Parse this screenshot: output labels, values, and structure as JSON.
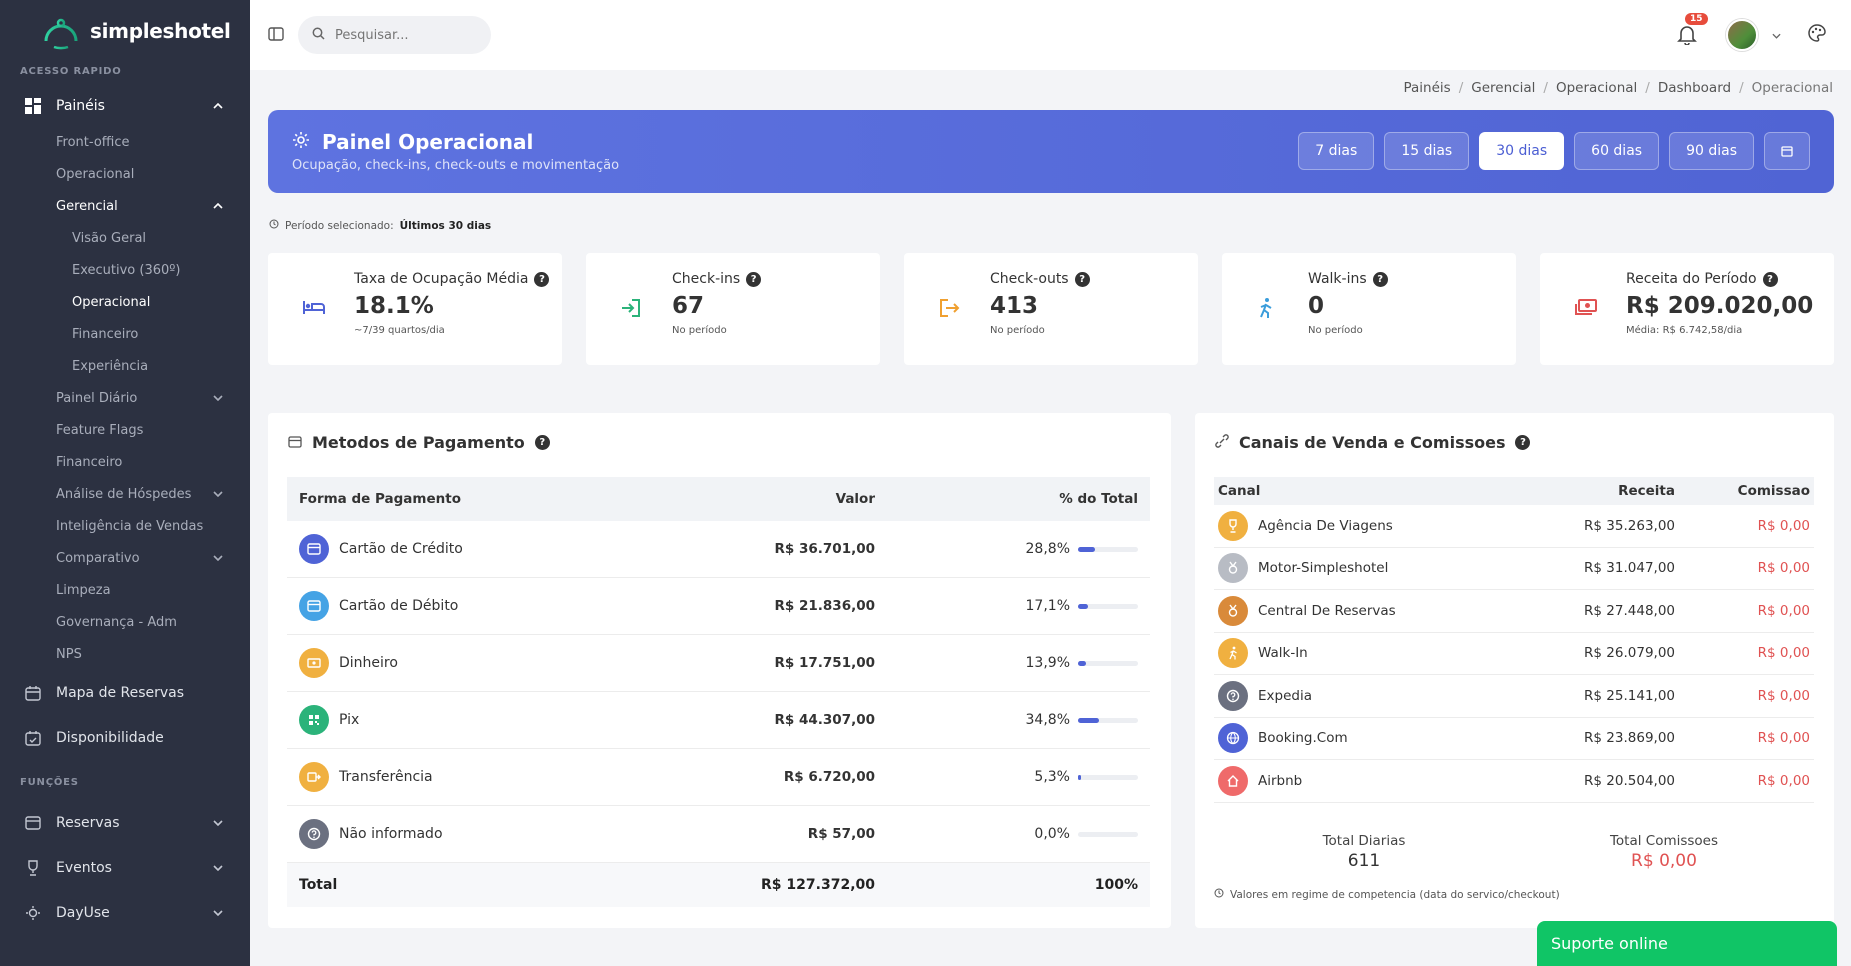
{
  "app": {
    "name": "simpleshotel"
  },
  "sidebar": {
    "section_quick": "ACESSO RAPIDO",
    "paineis": "Painéis",
    "sub": [
      "Front-office",
      "Operacional"
    ],
    "gerencial": "Gerencial",
    "gerencial_items": [
      "Visão Geral",
      "Executivo (360º)",
      "Operacional",
      "Financeiro",
      "Experiência"
    ],
    "more": [
      {
        "label": "Painel Diário",
        "chevron": true
      },
      {
        "label": "Feature Flags",
        "chevron": false
      },
      {
        "label": "Financeiro",
        "chevron": false
      },
      {
        "label": "Análise de Hóspedes",
        "chevron": true
      },
      {
        "label": "Inteligência de Vendas",
        "chevron": false
      },
      {
        "label": "Comparativo",
        "chevron": true
      },
      {
        "label": "Limpeza",
        "chevron": false
      },
      {
        "label": "Governança - Adm",
        "chevron": false
      },
      {
        "label": "NPS",
        "chevron": false
      }
    ],
    "mapa": "Mapa de Reservas",
    "disponibilidade": "Disponibilidade",
    "section_funcoes": "FUNÇÕES",
    "reservas": "Reservas",
    "eventos": "Eventos",
    "dayuse": "DayUse"
  },
  "topbar": {
    "search_placeholder": "Pesquisar...",
    "notifications": "15"
  },
  "breadcrumb": [
    "Painéis",
    "Gerencial",
    "Operacional",
    "Dashboard",
    "Operacional"
  ],
  "hero": {
    "title": "Painel Operacional",
    "subtitle": "Ocupação, check-ins, check-outs e movimentação",
    "ranges": [
      "7 dias",
      "15 dias",
      "30 dias",
      "60 dias",
      "90 dias"
    ],
    "active_range": "30 dias"
  },
  "period": {
    "label": "Período selecionado:",
    "value": "Últimos 30 dias"
  },
  "stats": [
    {
      "title": "Taxa de Ocupação Média",
      "value": "18.1%",
      "sub": "~7/39 quartos/dia",
      "color": "#4f63d6"
    },
    {
      "title": "Check-ins",
      "value": "67",
      "sub": "No período",
      "color": "#2bb37a"
    },
    {
      "title": "Check-outs",
      "value": "413",
      "sub": "No período",
      "color": "#f0a030"
    },
    {
      "title": "Walk-ins",
      "value": "0",
      "sub": "No período",
      "color": "#3b9ddb"
    },
    {
      "title": "Receita do Período",
      "value": "R$ 209.020,00",
      "sub": "Média: R$ 6.742,58/dia",
      "color": "#e05252"
    }
  ],
  "payments": {
    "title": "Metodos de Pagamento",
    "headers": [
      "Forma de Pagamento",
      "Valor",
      "% do Total"
    ],
    "rows": [
      {
        "name": "Cartão de Crédito",
        "value": "R$ 36.701,00",
        "pct": "28,8%",
        "frac": 0.288,
        "color": "#4f63d6"
      },
      {
        "name": "Cartão de Débito",
        "value": "R$ 21.836,00",
        "pct": "17,1%",
        "frac": 0.171,
        "color": "#45a3e5"
      },
      {
        "name": "Dinheiro",
        "value": "R$ 17.751,00",
        "pct": "13,9%",
        "frac": 0.139,
        "color": "#f0b040"
      },
      {
        "name": "Pix",
        "value": "R$ 44.307,00",
        "pct": "34,8%",
        "frac": 0.348,
        "color": "#2bb37a"
      },
      {
        "name": "Transferência",
        "value": "R$ 6.720,00",
        "pct": "5,3%",
        "frac": 0.053,
        "color": "#f0b040"
      },
      {
        "name": "Não informado",
        "value": "R$ 57,00",
        "pct": "0,0%",
        "frac": 0.0,
        "color": "#6b7080"
      }
    ],
    "total_label": "Total",
    "total_value": "R$ 127.372,00",
    "total_pct": "100%"
  },
  "channels": {
    "title": "Canais de Venda e Comissoes",
    "headers": [
      "Canal",
      "Receita",
      "Comissao"
    ],
    "rows": [
      {
        "name": "Agência De Viagens",
        "revenue": "R$ 35.263,00",
        "commission": "R$ 0,00",
        "color": "#f0b040"
      },
      {
        "name": "Motor-Simpleshotel",
        "revenue": "R$ 31.047,00",
        "commission": "R$ 0,00",
        "color": "#b8bcc4"
      },
      {
        "name": "Central De Reservas",
        "revenue": "R$ 27.448,00",
        "commission": "R$ 0,00",
        "color": "#d98a3a"
      },
      {
        "name": "Walk-In",
        "revenue": "R$ 26.079,00",
        "commission": "R$ 0,00",
        "color": "#f0b040"
      },
      {
        "name": "Expedia",
        "revenue": "R$ 25.141,00",
        "commission": "R$ 0,00",
        "color": "#6b7080"
      },
      {
        "name": "Booking.Com",
        "revenue": "R$ 23.869,00",
        "commission": "R$ 0,00",
        "color": "#4f63d6"
      },
      {
        "name": "Airbnb",
        "revenue": "R$ 20.504,00",
        "commission": "R$ 0,00",
        "color": "#ef6a6a"
      }
    ],
    "total_diarias_label": "Total Diarias",
    "total_diarias": "611",
    "total_comissoes_label": "Total Comissoes",
    "total_comissoes": "R$ 0,00",
    "note": "Valores em regime de competencia (data do servico/checkout)"
  },
  "chat": {
    "label": "Suporte online"
  }
}
